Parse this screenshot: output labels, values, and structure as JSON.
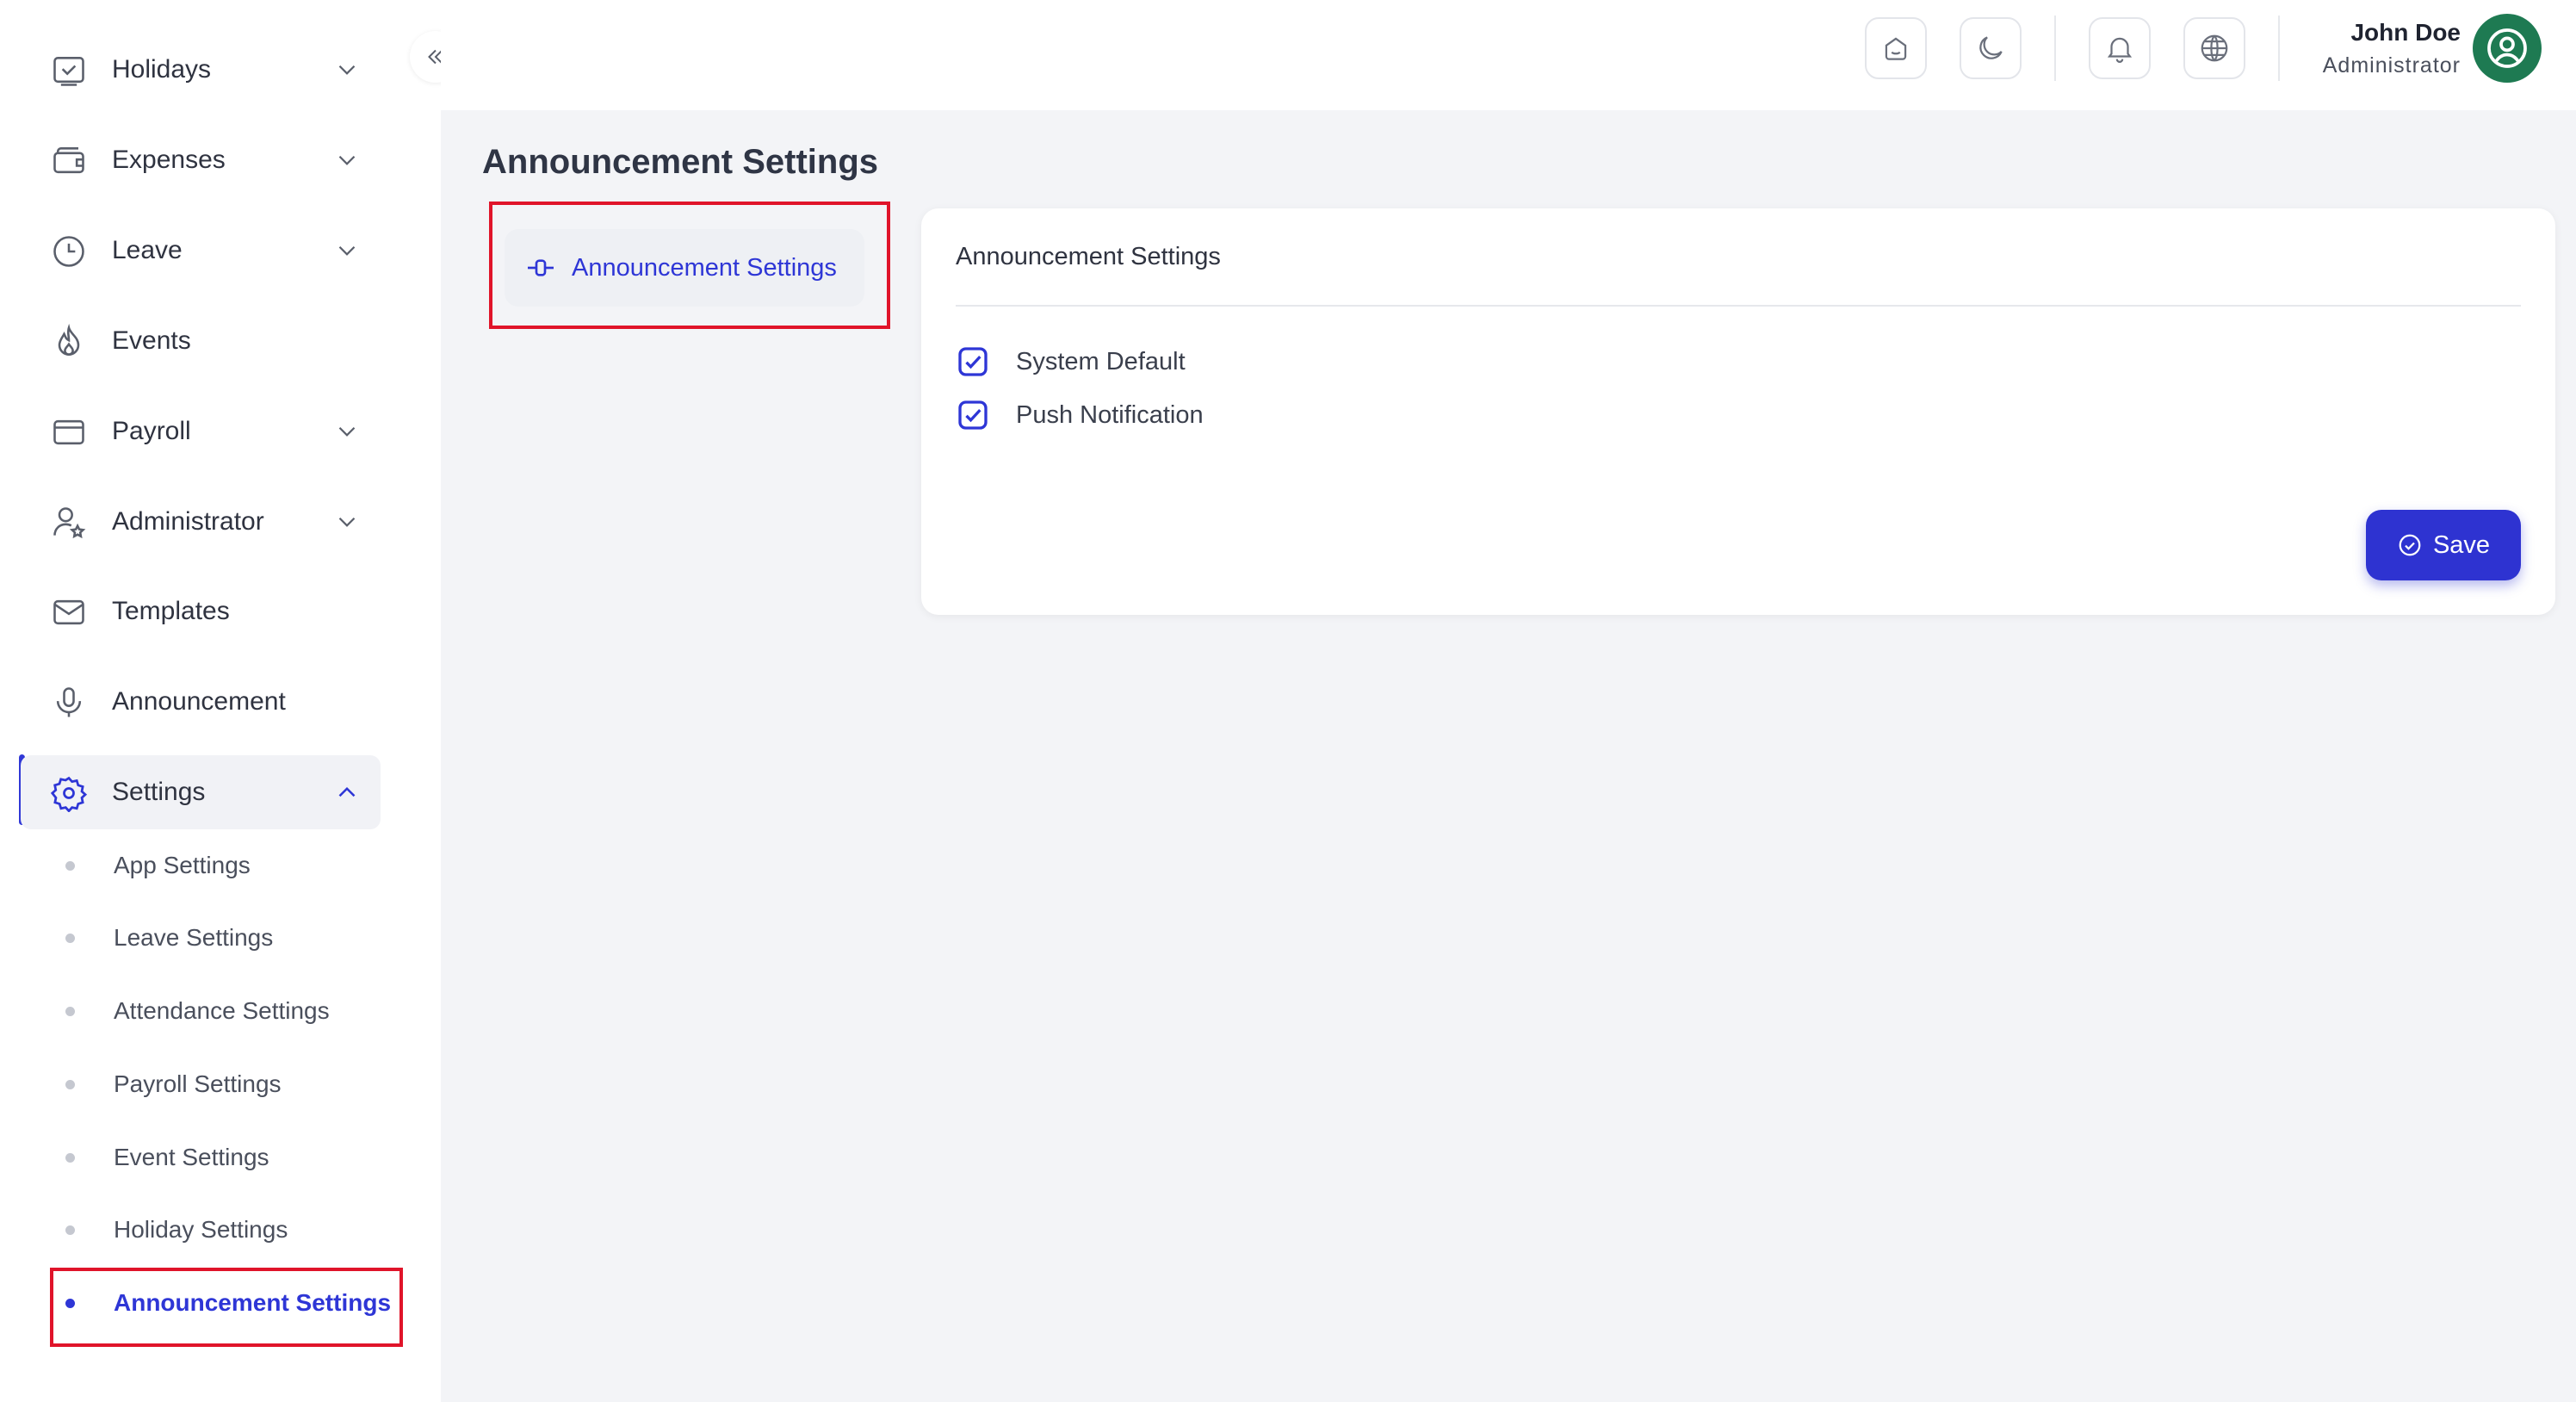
{
  "sidebar": {
    "items": [
      {
        "label": "Holidays",
        "icon": "calendar-check-icon",
        "has_chevron": true
      },
      {
        "label": "Expenses",
        "icon": "wallet-icon",
        "has_chevron": true
      },
      {
        "label": "Leave",
        "icon": "clock-icon",
        "has_chevron": true
      },
      {
        "label": "Events",
        "icon": "flame-icon",
        "has_chevron": false
      },
      {
        "label": "Payroll",
        "icon": "credit-card-icon",
        "has_chevron": true
      },
      {
        "label": "Administrator",
        "icon": "user-star-icon",
        "has_chevron": true
      },
      {
        "label": "Templates",
        "icon": "mail-icon",
        "has_chevron": false
      },
      {
        "label": "Announcement",
        "icon": "microphone-icon",
        "has_chevron": false
      },
      {
        "label": "Settings",
        "icon": "gear-icon",
        "has_chevron": true,
        "expanded": true,
        "active": true
      }
    ],
    "settings_subitems": [
      {
        "label": "App Settings"
      },
      {
        "label": "Leave Settings"
      },
      {
        "label": "Attendance Settings"
      },
      {
        "label": "Payroll Settings"
      },
      {
        "label": "Event Settings"
      },
      {
        "label": "Holiday Settings"
      },
      {
        "label": "Announcement Settings",
        "current": true
      }
    ]
  },
  "header": {
    "buttons": [
      "home-icon",
      "moon-icon",
      "bell-icon",
      "globe-icon"
    ],
    "user": {
      "name": "John Doe",
      "role": "Administrator"
    }
  },
  "main": {
    "page_title": "Announcement Settings",
    "tab": {
      "label": "Announcement Settings",
      "icon": "sliders-icon"
    },
    "card": {
      "title": "Announcement Settings",
      "options": [
        {
          "label": "System Default",
          "checked": true
        },
        {
          "label": "Push Notification",
          "checked": true
        }
      ],
      "save_label": "Save"
    }
  },
  "colors": {
    "accent": "#2e36d6",
    "highlight_frame": "#e0142a",
    "avatar": "#1e7a52",
    "background": "#f3f4f7"
  }
}
